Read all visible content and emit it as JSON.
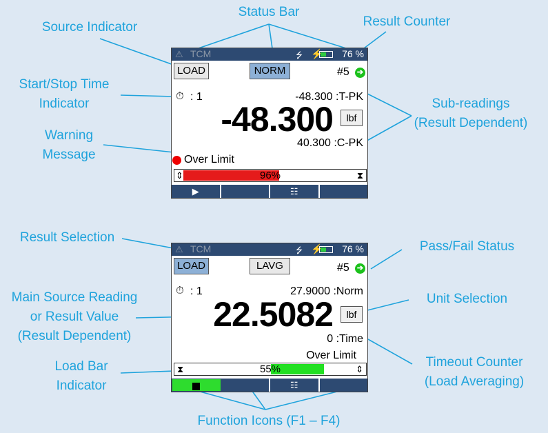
{
  "callouts": {
    "status_bar": "Status Bar",
    "source_indicator": "Source Indicator",
    "result_counter": "Result Counter",
    "start_stop_time": [
      "Start/Stop Time",
      "Indicator"
    ],
    "sub_readings": [
      "Sub-readings",
      "(Result Dependent)"
    ],
    "warning_message": [
      "Warning",
      "Message"
    ],
    "result_selection": "Result Selection",
    "pass_fail_status": "Pass/Fail Status",
    "main_source_reading": [
      "Main Source Reading",
      "or Result Value",
      "(Result Dependent)"
    ],
    "unit_selection": "Unit Selection",
    "timeout_counter": [
      "Timeout Counter",
      "(Load Averaging)"
    ],
    "load_bar_indicator": [
      "Load Bar",
      "Indicator"
    ],
    "function_icons": "Function Icons (F1 – F4)"
  },
  "screen1": {
    "status": {
      "warn_icon": "⚠",
      "app": "TCM",
      "usb_icon": "⭍",
      "charge_icon": "⚡",
      "battery_percent": "76 %"
    },
    "source_button": "LOAD",
    "result_button": "NORM",
    "result_counter": "#5",
    "pass_icon": "➔",
    "timer_icon": "⏱",
    "timer_text": ": 1",
    "sub_reading_top": "-48.300 :T-PK",
    "main_value": "-48.300",
    "unit": "lbf",
    "sub_reading_bottom": "40.300 :C-PK",
    "warning": "Over Limit",
    "load_bar": {
      "percent_label": "96%",
      "fill_fraction": 0.96,
      "fill_color": "#e51b1b",
      "left_icon": "⇕",
      "right_icon": "⧗"
    },
    "fkeys": [
      "▶",
      "",
      "☷",
      ""
    ]
  },
  "screen2": {
    "status": {
      "warn_icon": "⚠",
      "app": "TCM",
      "usb_icon": "⭍",
      "charge_icon": "⚡",
      "battery_percent": "76 %"
    },
    "source_button": "LOAD",
    "result_button": "LAVG",
    "result_counter": "#5",
    "pass_icon": "➔",
    "timer_icon": "⏱",
    "timer_text": ": 1",
    "sub_reading_top": "27.9000 :Norm",
    "main_value": "22.5082",
    "unit": "lbf",
    "sub_reading_bottom": "0 :Time",
    "warning": "Over Limit",
    "load_bar": {
      "percent_label": "55%",
      "fill_fraction": 0.55,
      "fill_color": "#22e022",
      "left_icon": "⧗",
      "right_icon": "⇕"
    },
    "fkeys": [
      "",
      "",
      "☷",
      ""
    ]
  }
}
